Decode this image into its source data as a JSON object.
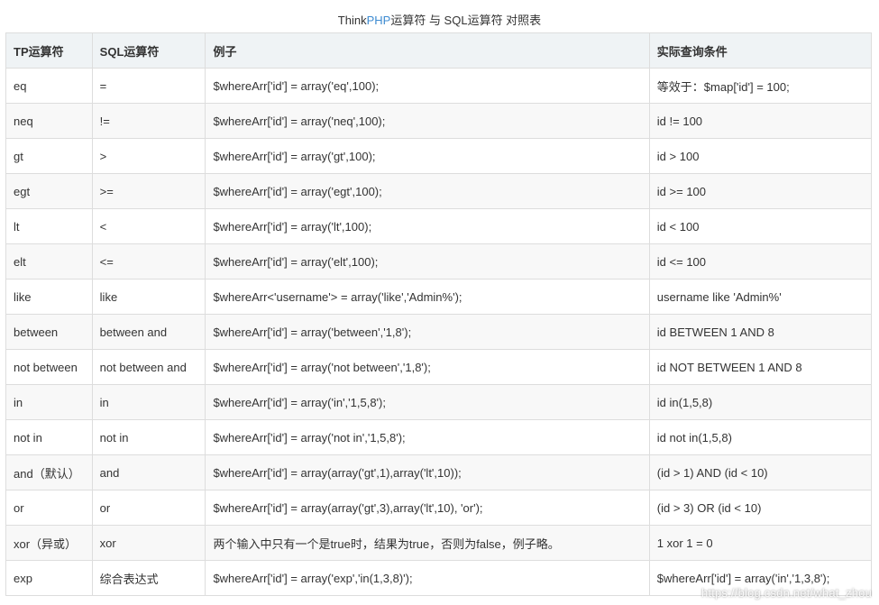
{
  "caption": {
    "prefix": "Think",
    "accent": "PHP",
    "suffix": "运算符 与 SQL运算符 对照表"
  },
  "colors": {
    "accent": "#3d8bd1",
    "header_bg": "#eff3f5",
    "stripe_bg": "#f8f8f8",
    "border": "#dddddd"
  },
  "table": {
    "headers": [
      "TP运算符",
      "SQL运算符",
      "例子",
      "实际查询条件"
    ],
    "rows": [
      [
        "eq",
        "=",
        "$whereArr['id'] = array('eq',100);",
        "等效于：$map['id'] = 100;"
      ],
      [
        "neq",
        "!=",
        "$whereArr['id'] = array('neq',100);",
        "id != 100"
      ],
      [
        "gt",
        ">",
        "$whereArr['id'] = array('gt',100);",
        "id > 100"
      ],
      [
        "egt",
        ">=",
        "$whereArr['id'] = array('egt',100);",
        "id >= 100"
      ],
      [
        "lt",
        "<",
        "$whereArr['id'] = array('lt',100);",
        "id < 100"
      ],
      [
        "elt",
        "<=",
        "$whereArr['id'] = array('elt',100);",
        "id <= 100"
      ],
      [
        "like",
        "like",
        "$whereArr<'username'> = array('like','Admin%');",
        "username like 'Admin%'"
      ],
      [
        "between",
        "between and",
        "$whereArr['id'] = array('between','1,8');",
        "id BETWEEN 1 AND 8"
      ],
      [
        "not between",
        "not between and",
        "$whereArr['id'] = array('not between','1,8');",
        "id NOT BETWEEN 1 AND 8"
      ],
      [
        "in",
        "in",
        "$whereArr['id'] = array('in','1,5,8');",
        "id in(1,5,8)"
      ],
      [
        "not in",
        "not in",
        "$whereArr['id'] = array('not in','1,5,8');",
        "id not in(1,5,8)"
      ],
      [
        "and（默认）",
        "and",
        "$whereArr['id'] = array(array('gt',1),array('lt',10));",
        "(id > 1) AND (id < 10)"
      ],
      [
        "or",
        "or",
        "$whereArr['id'] = array(array('gt',3),array('lt',10), 'or');",
        "(id > 3) OR (id < 10)"
      ],
      [
        "xor（异或）",
        "xor",
        "两个输入中只有一个是true时，结果为true，否则为false，例子略。",
        "1 xor 1 = 0"
      ],
      [
        "exp",
        "综合表达式",
        "$whereArr['id'] = array('exp','in(1,3,8)');",
        "$whereArr['id'] = array('in','1,3,8');"
      ]
    ]
  },
  "watermark": "https://blog.csdn.net/what_zhou"
}
